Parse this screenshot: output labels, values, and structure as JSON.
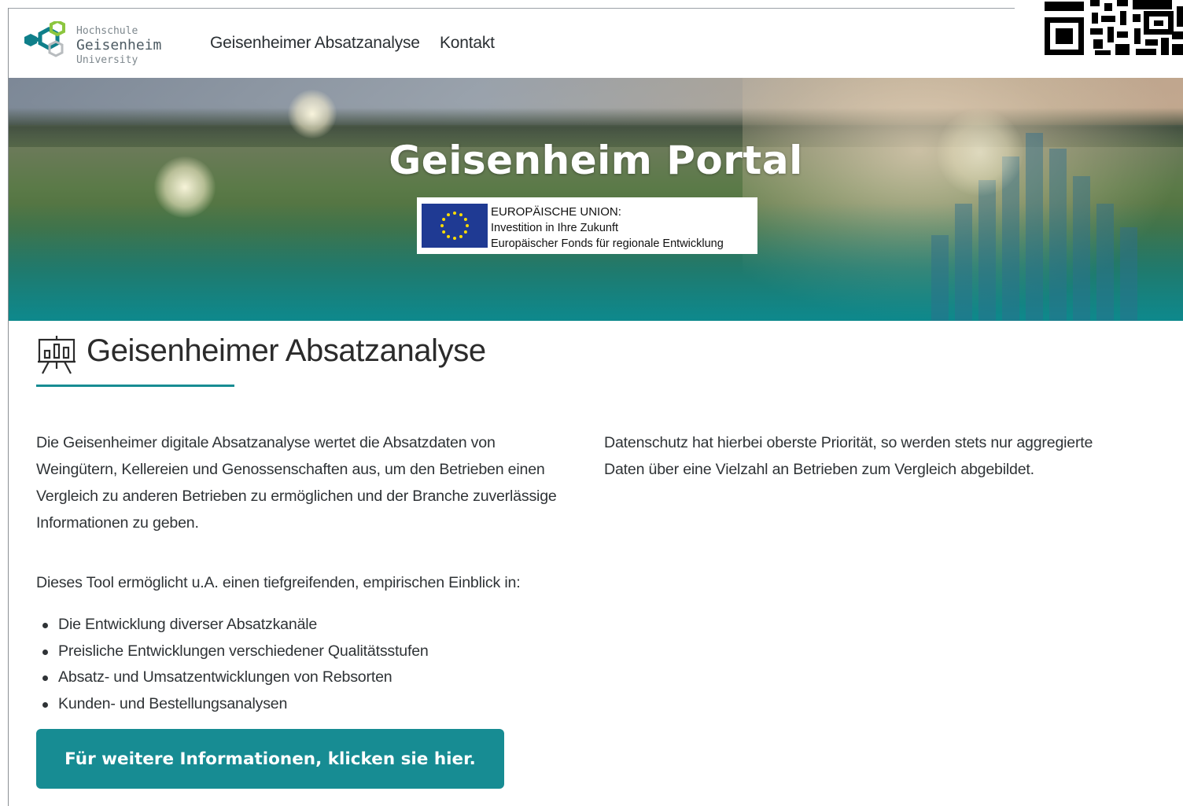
{
  "header": {
    "logo": {
      "line1": "Hochschule",
      "line2": "Geisenheim",
      "line3": "University"
    },
    "nav": [
      {
        "label": "Geisenheimer Absatzanalyse"
      },
      {
        "label": "Kontakt"
      }
    ]
  },
  "hero": {
    "title": "Geisenheim Portal",
    "eu_badge": {
      "line1": "EUROPÄISCHE UNION:",
      "line2": "Investition in Ihre Zukunft",
      "line3": "Europäischer Fonds für regionale Entwicklung"
    }
  },
  "main": {
    "heading": "Geisenheimer Absatzanalyse",
    "left_paragraph_lines": [
      "Die Geisenheimer digitale Absatzanalyse wertet die Absatzdaten von",
      "Weingütern, Kellereien und Genossenschaften aus, um den Betrieben einen",
      "Vergleich zu anderen Betrieben zu ermöglichen und der Branche zuverlässige",
      "Informationen zu geben."
    ],
    "right_paragraph_lines": [
      "Datenschutz hat hierbei oberste Priorität, so werden stets nur aggregierte",
      "Daten über eine Vielzahl an Betrieben zum Vergleich abgebildet."
    ],
    "list_intro": "Dieses Tool ermöglicht u.A. einen tiefgreifenden, empirischen Einblick in:",
    "list_items": [
      "Die Entwicklung diverser Absatzkanäle",
      "Preisliche Entwicklungen verschiedener Qualitätsstufen",
      "Absatz- und Umsatzentwicklungen von Rebsorten",
      "Kunden- und Bestellungsanalysen"
    ],
    "cta_label": "Für weitere Informationen, klicken sie hier."
  },
  "colors": {
    "accent": "#178c93",
    "text": "#2f3336",
    "eu_blue": "#1f3a93",
    "eu_star": "#ffdd00"
  },
  "icons": {
    "logo": "hexagon-logo-icon",
    "heading": "presentation-board-icon",
    "qr": "qr-code-icon",
    "eu_flag": "eu-flag-icon"
  }
}
